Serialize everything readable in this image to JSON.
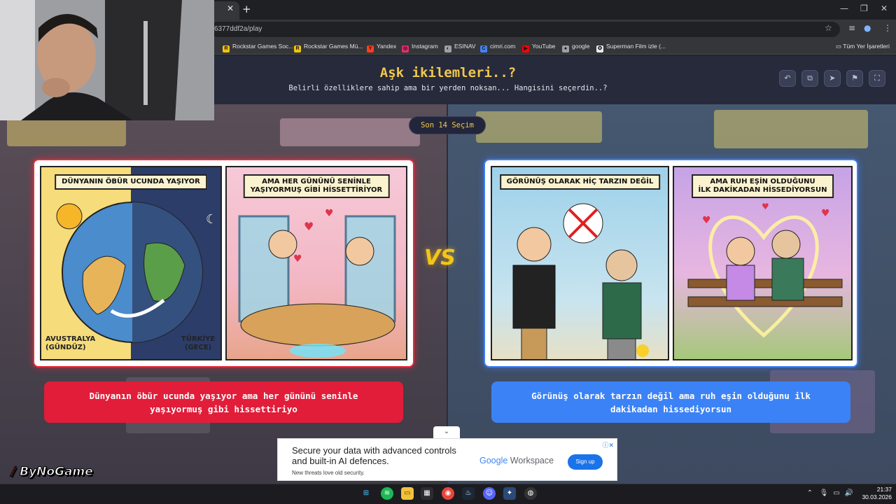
{
  "browser": {
    "url": "6377ddf2a/play",
    "tab_close": "✕",
    "new_tab": "+",
    "bookmarks": [
      {
        "label": "Rockstar Games Soc...",
        "color": "#f4c20d",
        "icon": "R"
      },
      {
        "label": "Rockstar Games Mü...",
        "color": "#f4c20d",
        "icon": "R"
      },
      {
        "label": "Yandex",
        "color": "#fc3f1d",
        "icon": "Y"
      },
      {
        "label": "Instagram",
        "color": "#e1306c",
        "icon": "◎"
      },
      {
        "label": "ESINAV",
        "color": "#9aa0a6",
        "icon": "◐"
      },
      {
        "label": "cimri.com",
        "color": "#4285f4",
        "icon": "C"
      },
      {
        "label": "YouTube",
        "color": "#ff0000",
        "icon": "▶"
      },
      {
        "label": "google",
        "color": "#9aa0a6",
        "icon": "●"
      },
      {
        "label": "Superman Film izle (...",
        "color": "#e8eaed",
        "icon": "✪"
      }
    ],
    "all_bookmarks": "Tüm Yer İşaretleri"
  },
  "page": {
    "title": "Aşk ikilemleri..?",
    "subtitle": "Belirli özelliklere sahip ama bir yerden noksan... Hangisini seçerdin..?",
    "badge": "Son 14 Seçim",
    "vs": "VS",
    "left": {
      "panel1_caption": "DÜNYANIN ÖBÜR UCUNDA YAŞIYOR",
      "panel1_label_left": "AVUSTRALYA\n(GÜNDÜZ)",
      "panel1_label_right": "TÜRKİYE\n(GECE)",
      "panel2_caption": "AMA HER GÜNÜNÜ SENİNLE\nYAŞIYORMUŞ GİBİ HİSSETTİRİYOR",
      "answer": "Dünyanın öbür ucunda yaşıyor ama her gününü seninle yaşıyormuş gibi hissettiriyo"
    },
    "right": {
      "panel1_caption": "GÖRÜNÜŞ OLARAK HİÇ TARZIN DEĞİL",
      "panel2_caption": "AMA RUH EŞİN OLDUĞUNU\nİLK DAKİKADAN HİSSEDİYORSUN",
      "answer": "Görünüş olarak tarzın değil ama ruh eşin olduğunu ilk dakikadan hissediyorsun"
    }
  },
  "ad": {
    "headline": "Secure your data with advanced controls and built-in AI defences.",
    "sub": "New threats love old security.",
    "brand_google": "Google",
    "brand_product": " Workspace",
    "cta": "Sign up",
    "toggle": "⌄",
    "info": "ⓘ✕"
  },
  "overlay": {
    "logo_slash": "/",
    "logo_text": "ByNoGame"
  },
  "taskbar": {
    "time": "21:37",
    "date": "30.03.2026"
  },
  "colors": {
    "accent_yellow": "#f2c84b",
    "left_red": "#e11d3a",
    "right_blue": "#3b82f6"
  }
}
